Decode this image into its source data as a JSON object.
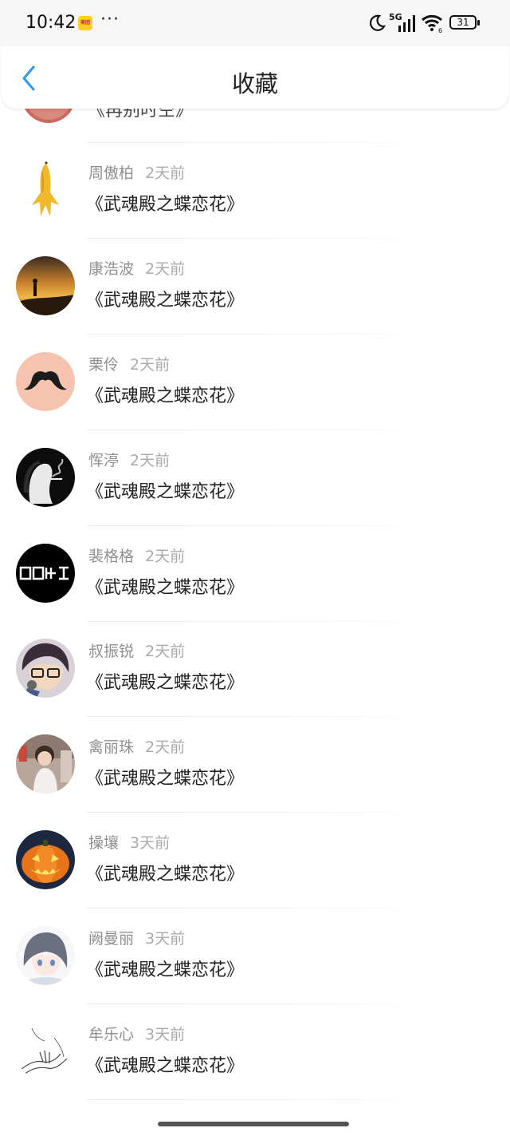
{
  "status_bar": {
    "time": "10:42",
    "app_badge": "美团",
    "more": "···",
    "network": "5G",
    "wifi_sub": "6",
    "battery": "31"
  },
  "header": {
    "title": "收藏",
    "back_icon": "chevron-left-icon"
  },
  "partial_item": {
    "title": "《再别时空》"
  },
  "items": [
    {
      "author": "周傲柏",
      "time": "2天前",
      "book": "《武魂殿之蝶恋花》",
      "avatar": "banana"
    },
    {
      "author": "康浩波",
      "time": "2天前",
      "book": "《武魂殿之蝶恋花》",
      "avatar": "sunset"
    },
    {
      "author": "栗伶",
      "time": "2天前",
      "book": "《武魂殿之蝶恋花》",
      "avatar": "mustache"
    },
    {
      "author": "恽渟",
      "time": "2天前",
      "book": "《武魂殿之蝶恋花》",
      "avatar": "smoke-portrait"
    },
    {
      "author": "裴格格",
      "time": "2天前",
      "book": "《武魂殿之蝶恋花》",
      "avatar": "black-logo"
    },
    {
      "author": "叔振锐",
      "time": "2天前",
      "book": "《武魂殿之蝶恋花》",
      "avatar": "anime-boy"
    },
    {
      "author": "禽丽珠",
      "time": "2天前",
      "book": "《武魂殿之蝶恋花》",
      "avatar": "photo-girl"
    },
    {
      "author": "操壤",
      "time": "3天前",
      "book": "《武魂殿之蝶恋花》",
      "avatar": "pumpkin"
    },
    {
      "author": "阙曼丽",
      "time": "3天前",
      "book": "《武魂殿之蝶恋花》",
      "avatar": "anime-girl"
    },
    {
      "author": "牟乐心",
      "time": "3天前",
      "book": "《武魂殿之蝶恋花》",
      "avatar": "sketch-hand"
    }
  ]
}
